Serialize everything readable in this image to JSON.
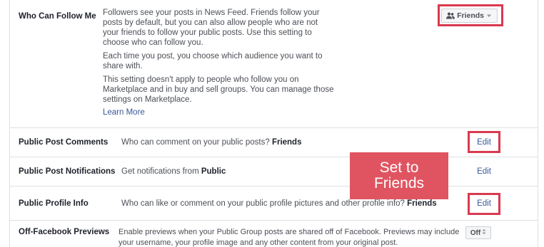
{
  "who_can_follow": {
    "label": "Who Can Follow Me",
    "paragraph_1": "Followers see your posts in News Feed. Friends follow your posts by default, but you can also allow people who are not your friends to follow your public posts. Use this setting to choose who can follow you.",
    "paragraph_2": "Each time you post, you choose which audience you want to share with.",
    "paragraph_3": "This setting doesn't apply to people who follow you on Marketplace and in buy and sell groups. You can manage those settings on Marketplace.",
    "learn_more": "Learn More",
    "audience_button": "Friends",
    "audience_icon": "friends-icon"
  },
  "public_post_comments": {
    "label": "Public Post Comments",
    "desc_prefix": "Who can comment on your public posts? ",
    "desc_value": "Friends",
    "edit": "Edit"
  },
  "public_post_notifications": {
    "label": "Public Post Notifications",
    "desc_prefix": "Get notifications from ",
    "desc_value": "Public",
    "edit": "Edit"
  },
  "public_profile_info": {
    "label": "Public Profile Info",
    "desc_prefix": "Who can like or comment on your public profile pictures and other profile info? ",
    "desc_value": "Friends",
    "edit": "Edit"
  },
  "off_facebook_previews": {
    "label": "Off-Facebook Previews",
    "desc_line_1": "Enable previews when your Public Group posts are shared off of Facebook. Previews may include",
    "desc_line_2": "your username, your profile image and any other content from your original post.",
    "toggle_value": "Off"
  },
  "callout": {
    "line_1": "Set to",
    "line_2": "Friends"
  },
  "colors": {
    "highlight": "#d9394e",
    "callout_bg": "#e05461",
    "link": "#365899"
  }
}
